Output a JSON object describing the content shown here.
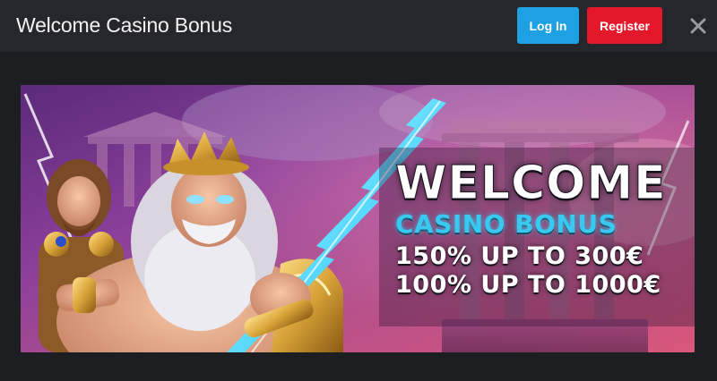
{
  "header": {
    "title": "Welcome Casino Bonus",
    "login_label": "Log In",
    "register_label": "Register",
    "close_icon": "close-icon"
  },
  "banner": {
    "headline": "WELCOME",
    "subheadline": "CASINO BONUS",
    "offer_1": "150% UP TO 300€",
    "offer_2": "100% UP TO 1000€",
    "image_description_icon": "zeus-artwork"
  },
  "colors": {
    "header_bg": "#26272c",
    "page_bg": "#1d1e22",
    "login_button": "#1da1e2",
    "register_button": "#e3192b",
    "casino_bonus_text": "#39c8f0"
  }
}
